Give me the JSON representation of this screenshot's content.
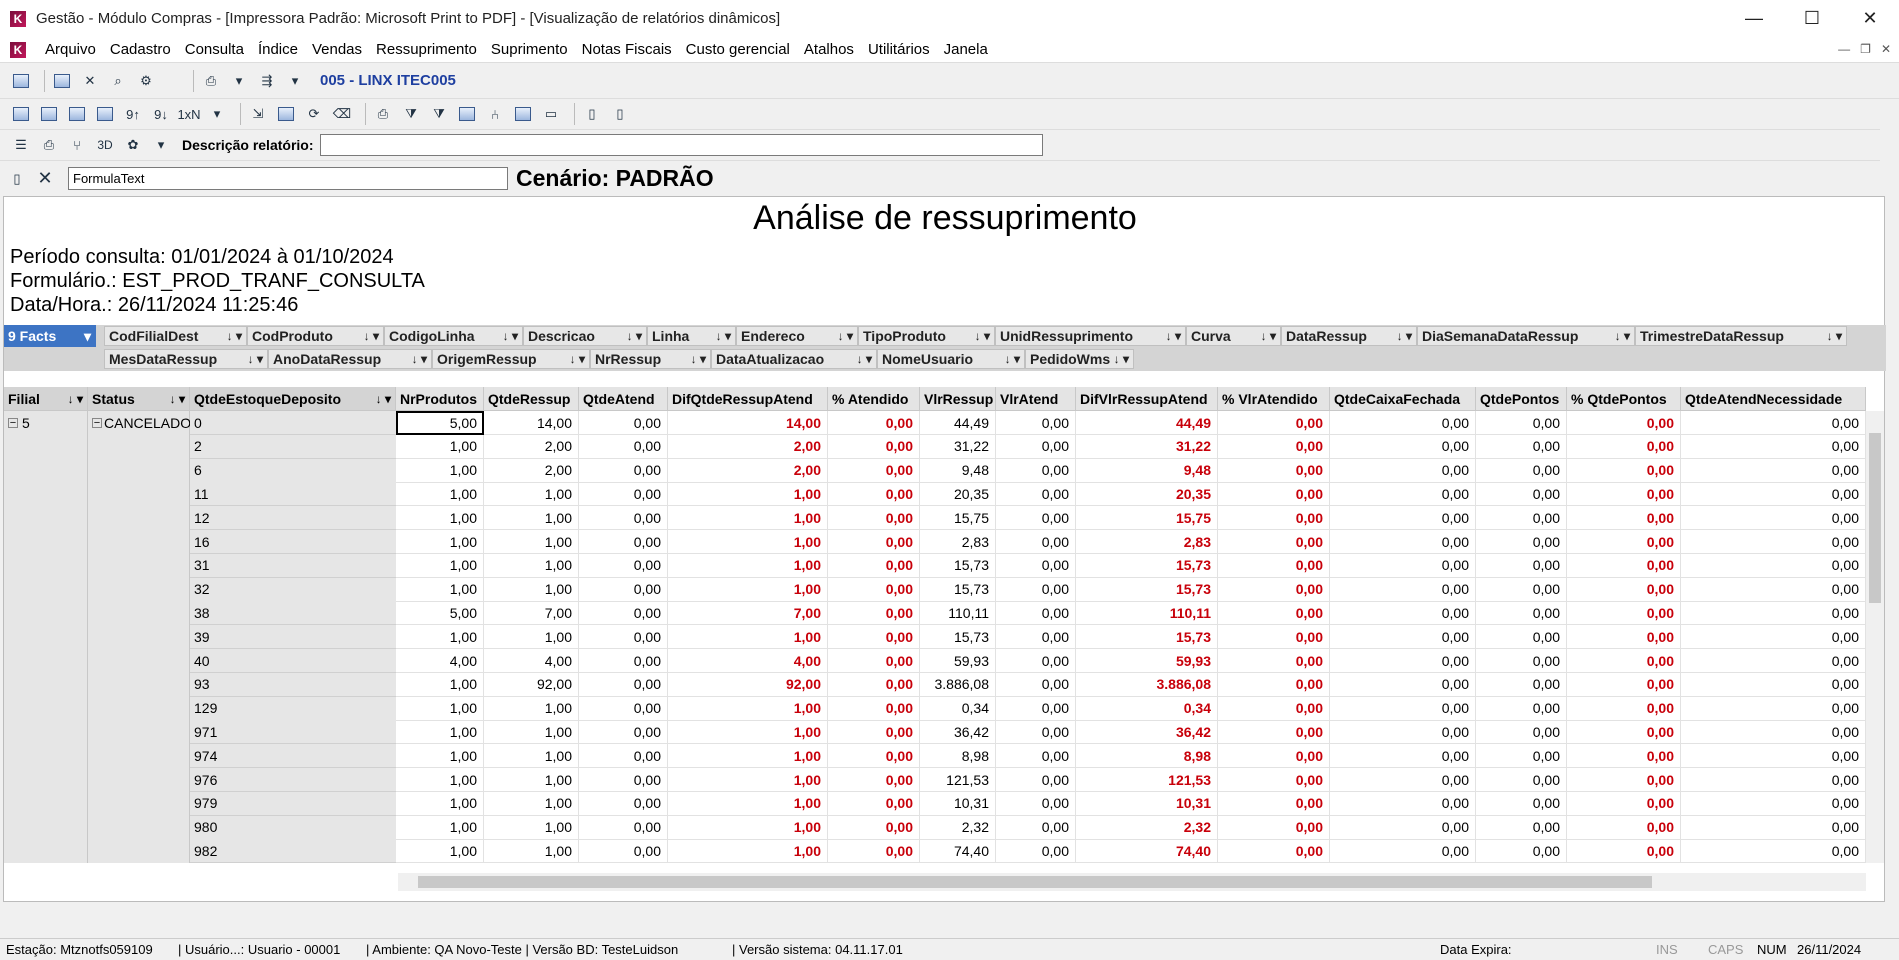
{
  "window": {
    "title": "Gestão - Módulo Compras - [Impressora Padrão: Microsoft Print to PDF] - [Visualização de relatórios dinâmicos]"
  },
  "menu": [
    "Arquivo",
    "Cadastro",
    "Consulta",
    "Índice",
    "Vendas",
    "Ressuprimento",
    "Suprimento",
    "Notas Fiscais",
    "Custo gerencial",
    "Atalhos",
    "Utilitários",
    "Janela"
  ],
  "toolbar": {
    "company": "005 - LINX ITEC005",
    "description_label": "Descrição relatório:",
    "three_d": "3D"
  },
  "formula": {
    "value": "FormulaText",
    "scenario": "Cenário: PADRÃO"
  },
  "report": {
    "title": "Análise de ressuprimento",
    "period": "Período consulta: 01/01/2024 à 01/10/2024",
    "form": "Formulário.: EST_PROD_TRANF_CONSULTA",
    "datetime": "Data/Hora.: 26/11/2024 11:25:46"
  },
  "facts_label": "9 Facts",
  "filters_row1": [
    "CodFilialDest",
    "CodProduto",
    "CodigoLinha",
    "Descricao",
    "Linha",
    "Endereco",
    "TipoProduto",
    "UnidRessuprimento",
    "Curva",
    "DataRessup",
    "DiaSemanaDataRessup",
    "TrimestreDataRessup"
  ],
  "filters_row2": [
    "MesDataRessup",
    "AnoDataRessup",
    "OrigemRessup",
    "NrRessup",
    "DataAtualizacao",
    "NomeUsuario",
    "PedidoWms"
  ],
  "row_headers": [
    "Filial",
    "Status",
    "QtdeEstoqueDeposito"
  ],
  "columns": [
    "NrProdutos",
    "QtdeRessup",
    "QtdeAtend",
    "DifQtdeRessupAtend",
    "% Atendido",
    "VlrRessup",
    "VlrAtend",
    "DifVlrRessupAtend",
    "% VlrAtendido",
    "QtdeCaixaFechada",
    "QtdePontos",
    "% QtdePontos",
    "QtdeAtendNecessidade"
  ],
  "filial": "5",
  "status": "CANCELADO",
  "rows": [
    {
      "code": "0",
      "v": [
        "5,00",
        "14,00",
        "0,00",
        "14,00",
        "0,00",
        "44,49",
        "0,00",
        "44,49",
        "0,00",
        "0,00",
        "0,00",
        "0,00",
        "0,00"
      ]
    },
    {
      "code": "2",
      "v": [
        "1,00",
        "2,00",
        "0,00",
        "2,00",
        "0,00",
        "31,22",
        "0,00",
        "31,22",
        "0,00",
        "0,00",
        "0,00",
        "0,00",
        "0,00"
      ]
    },
    {
      "code": "6",
      "v": [
        "1,00",
        "2,00",
        "0,00",
        "2,00",
        "0,00",
        "9,48",
        "0,00",
        "9,48",
        "0,00",
        "0,00",
        "0,00",
        "0,00",
        "0,00"
      ]
    },
    {
      "code": "11",
      "v": [
        "1,00",
        "1,00",
        "0,00",
        "1,00",
        "0,00",
        "20,35",
        "0,00",
        "20,35",
        "0,00",
        "0,00",
        "0,00",
        "0,00",
        "0,00"
      ]
    },
    {
      "code": "12",
      "v": [
        "1,00",
        "1,00",
        "0,00",
        "1,00",
        "0,00",
        "15,75",
        "0,00",
        "15,75",
        "0,00",
        "0,00",
        "0,00",
        "0,00",
        "0,00"
      ]
    },
    {
      "code": "16",
      "v": [
        "1,00",
        "1,00",
        "0,00",
        "1,00",
        "0,00",
        "2,83",
        "0,00",
        "2,83",
        "0,00",
        "0,00",
        "0,00",
        "0,00",
        "0,00"
      ]
    },
    {
      "code": "31",
      "v": [
        "1,00",
        "1,00",
        "0,00",
        "1,00",
        "0,00",
        "15,73",
        "0,00",
        "15,73",
        "0,00",
        "0,00",
        "0,00",
        "0,00",
        "0,00"
      ]
    },
    {
      "code": "32",
      "v": [
        "1,00",
        "1,00",
        "0,00",
        "1,00",
        "0,00",
        "15,73",
        "0,00",
        "15,73",
        "0,00",
        "0,00",
        "0,00",
        "0,00",
        "0,00"
      ]
    },
    {
      "code": "38",
      "v": [
        "5,00",
        "7,00",
        "0,00",
        "7,00",
        "0,00",
        "110,11",
        "0,00",
        "110,11",
        "0,00",
        "0,00",
        "0,00",
        "0,00",
        "0,00"
      ]
    },
    {
      "code": "39",
      "v": [
        "1,00",
        "1,00",
        "0,00",
        "1,00",
        "0,00",
        "15,73",
        "0,00",
        "15,73",
        "0,00",
        "0,00",
        "0,00",
        "0,00",
        "0,00"
      ]
    },
    {
      "code": "40",
      "v": [
        "4,00",
        "4,00",
        "0,00",
        "4,00",
        "0,00",
        "59,93",
        "0,00",
        "59,93",
        "0,00",
        "0,00",
        "0,00",
        "0,00",
        "0,00"
      ]
    },
    {
      "code": "93",
      "v": [
        "1,00",
        "92,00",
        "0,00",
        "92,00",
        "0,00",
        "3.886,08",
        "0,00",
        "3.886,08",
        "0,00",
        "0,00",
        "0,00",
        "0,00",
        "0,00"
      ]
    },
    {
      "code": "129",
      "v": [
        "1,00",
        "1,00",
        "0,00",
        "1,00",
        "0,00",
        "0,34",
        "0,00",
        "0,34",
        "0,00",
        "0,00",
        "0,00",
        "0,00",
        "0,00"
      ]
    },
    {
      "code": "971",
      "v": [
        "1,00",
        "1,00",
        "0,00",
        "1,00",
        "0,00",
        "36,42",
        "0,00",
        "36,42",
        "0,00",
        "0,00",
        "0,00",
        "0,00",
        "0,00"
      ]
    },
    {
      "code": "974",
      "v": [
        "1,00",
        "1,00",
        "0,00",
        "1,00",
        "0,00",
        "8,98",
        "0,00",
        "8,98",
        "0,00",
        "0,00",
        "0,00",
        "0,00",
        "0,00"
      ]
    },
    {
      "code": "976",
      "v": [
        "1,00",
        "1,00",
        "0,00",
        "1,00",
        "0,00",
        "121,53",
        "0,00",
        "121,53",
        "0,00",
        "0,00",
        "0,00",
        "0,00",
        "0,00"
      ]
    },
    {
      "code": "979",
      "v": [
        "1,00",
        "1,00",
        "0,00",
        "1,00",
        "0,00",
        "10,31",
        "0,00",
        "10,31",
        "0,00",
        "0,00",
        "0,00",
        "0,00",
        "0,00"
      ]
    },
    {
      "code": "980",
      "v": [
        "1,00",
        "1,00",
        "0,00",
        "1,00",
        "0,00",
        "2,32",
        "0,00",
        "2,32",
        "0,00",
        "0,00",
        "0,00",
        "0,00",
        "0,00"
      ]
    },
    {
      "code": "982",
      "v": [
        "1,00",
        "1,00",
        "0,00",
        "1,00",
        "0,00",
        "74,40",
        "0,00",
        "74,40",
        "0,00",
        "0,00",
        "0,00",
        "0,00",
        "0,00"
      ]
    }
  ],
  "red_columns": [
    3,
    4,
    7,
    8,
    11
  ],
  "statusbar": {
    "estacao": "Estação: Mtznotfs059109",
    "usuario": "| Usuário...: Usuario - 00001",
    "ambiente": "| Ambiente: QA Novo-Teste | Versão BD: TesteLuidson",
    "versao": "| Versão sistema: 04.11.17.01",
    "expira": "Data Expira:",
    "ins": "INS",
    "caps": "CAPS",
    "num": "NUM",
    "date": "26/11/2024"
  },
  "colors": {
    "accent": "#3d74c4",
    "negative": "#c8000a"
  }
}
